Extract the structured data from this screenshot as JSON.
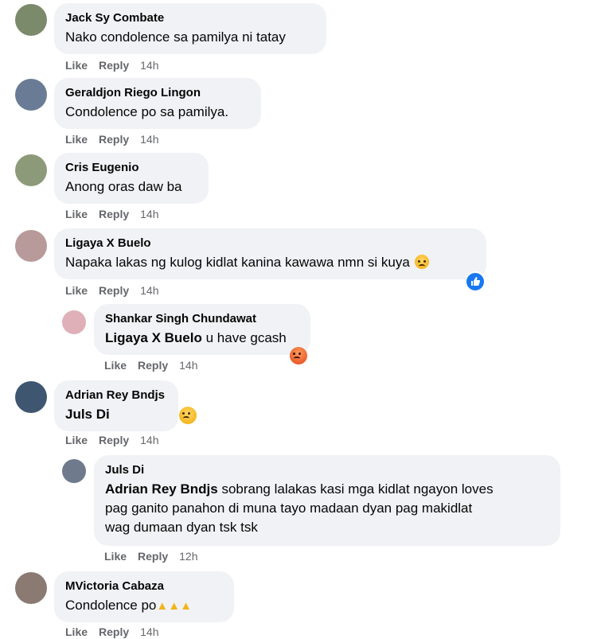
{
  "actions": {
    "like": "Like",
    "reply": "Reply"
  },
  "comments": [
    {
      "author": "Jack Sy Combate",
      "text": "Nako condolence sa pamilya ni tatay",
      "time": "14h",
      "avatar_color": "#7a8a6a"
    },
    {
      "author": "Geraldjon Riego Lingon",
      "text": "Condolence po sa pamilya.",
      "time": "14h",
      "avatar_color": "#6a7c95"
    },
    {
      "author": "Cris Eugenio",
      "text": "Anong oras daw ba",
      "time": "14h",
      "avatar_color": "#8d9a7a"
    },
    {
      "author": "Ligaya X Buelo",
      "text": "Napaka lakas ng kulog kidlat kanina kawawa nmn si kuya",
      "time": "14h",
      "avatar_color": "#b89a9a",
      "reaction_icon": "sad-emoji",
      "like_badge": "like-reaction-icon"
    },
    {
      "author": "Shankar Singh Chundawat",
      "mention": "Ligaya X Buelo",
      "text": "u have gcash",
      "time": "14h",
      "avatar_color": "#e0b0b8",
      "reaction_icon": "angry-emoji"
    },
    {
      "author": "Adrian Rey Bndjs",
      "mention": "Juls Di",
      "text": "",
      "time": "14h",
      "avatar_color": "#3e5670",
      "reaction_icon": "sad-emoji"
    },
    {
      "author": "Juls Di",
      "mention": "Adrian Rey Bndjs",
      "text_line1": "sobrang lalakas kasi mga kidlat ngayon loves",
      "text_line2": "pag ganito panahon di muna tayo madaan dyan pag makidlat",
      "text_line3": "wag dumaan dyan tsk tsk",
      "time": "12h",
      "avatar_color": "#6f7b8c"
    },
    {
      "author": "MVictoria Cabaza",
      "text": "Condolence po",
      "time": "14h",
      "avatar_color": "#8a7a72",
      "reaction_icon": "pray-emoji",
      "reaction_count": 3
    }
  ]
}
